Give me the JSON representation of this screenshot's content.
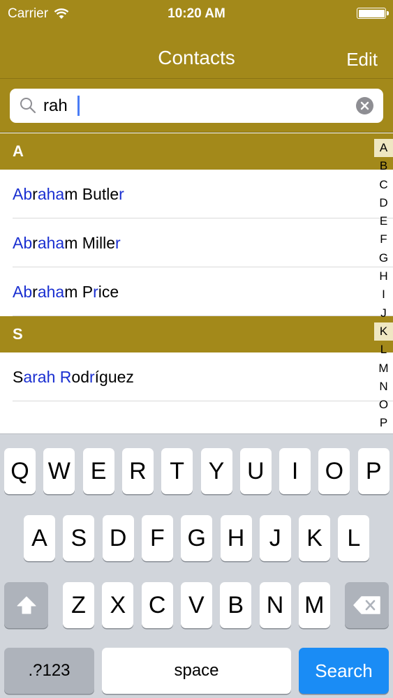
{
  "status": {
    "carrier": "Carrier",
    "time": "10:20 AM"
  },
  "nav": {
    "title": "Contacts",
    "edit_label": "Edit"
  },
  "search": {
    "value": "rah",
    "placeholder": ""
  },
  "sections": [
    {
      "letter": "A",
      "rows": [
        {
          "parts": [
            [
              "Ab",
              true
            ],
            [
              "r",
              false
            ],
            [
              "aha",
              true
            ],
            [
              "m Butle",
              false
            ],
            [
              "r",
              true
            ]
          ]
        },
        {
          "parts": [
            [
              "Ab",
              true
            ],
            [
              "r",
              false
            ],
            [
              "aha",
              true
            ],
            [
              "m Mille",
              false
            ],
            [
              "r",
              true
            ]
          ]
        },
        {
          "parts": [
            [
              "Ab",
              true
            ],
            [
              "r",
              false
            ],
            [
              "aha",
              true
            ],
            [
              "m P",
              false
            ],
            [
              "r",
              true
            ],
            [
              "ice",
              false
            ]
          ]
        }
      ]
    },
    {
      "letter": "S",
      "rows": [
        {
          "parts": [
            [
              "S",
              false
            ],
            [
              "arah",
              true
            ],
            [
              " ",
              false
            ],
            [
              "R",
              true
            ],
            [
              "od",
              false
            ],
            [
              "r",
              true
            ],
            [
              "íguez",
              false
            ]
          ]
        },
        {
          "parts": []
        }
      ]
    }
  ],
  "index_letters": [
    "A",
    "B",
    "C",
    "D",
    "E",
    "F",
    "G",
    "H",
    "I",
    "J",
    "K",
    "L",
    "M",
    "N",
    "O",
    "P"
  ],
  "index_highlight": [
    "A",
    "K"
  ],
  "keyboard": {
    "row1": [
      "Q",
      "W",
      "E",
      "R",
      "T",
      "Y",
      "U",
      "I",
      "O",
      "P"
    ],
    "row2": [
      "A",
      "S",
      "D",
      "F",
      "G",
      "H",
      "J",
      "K",
      "L"
    ],
    "row3": [
      "Z",
      "X",
      "C",
      "V",
      "B",
      "N",
      "M"
    ],
    "numbers_label": ".?123",
    "space_label": "space",
    "search_label": "Search"
  },
  "colors": {
    "bar": "#a3891a",
    "highlight_text": "#1a2fd1",
    "search_key": "#1a8cf5"
  }
}
